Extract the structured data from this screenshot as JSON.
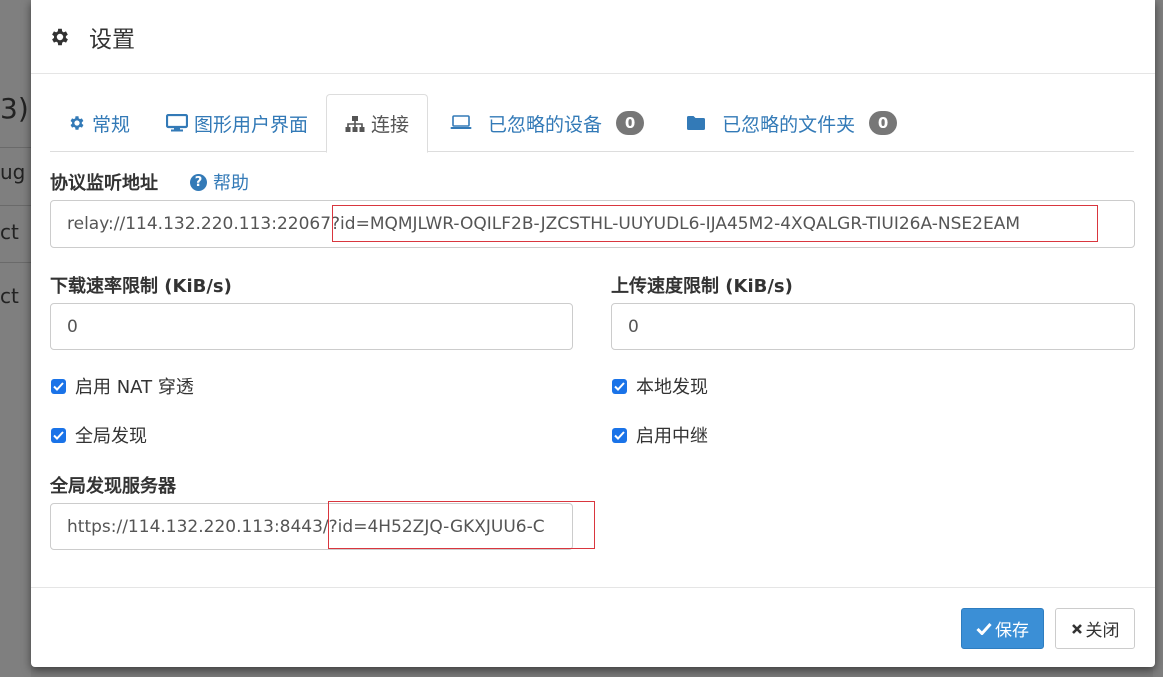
{
  "background": {
    "left_texts": [
      "3)",
      "ug",
      "ct",
      "ct"
    ]
  },
  "dialog": {
    "title": "设置",
    "icon": "gear-icon"
  },
  "tabs": [
    {
      "label": "常规",
      "icon": "cog-icon",
      "active": false
    },
    {
      "label": "图形用户界面",
      "icon": "monitor-icon",
      "active": false
    },
    {
      "label": "连接",
      "icon": "sitemap-icon",
      "active": true
    },
    {
      "label": "已忽略的设备",
      "icon": "laptop-icon",
      "active": false,
      "badge": "0"
    },
    {
      "label": "已忽略的文件夹",
      "icon": "folder-icon",
      "active": false,
      "badge": "0"
    }
  ],
  "form": {
    "listen_label": "协议监听地址",
    "help_label": "帮助",
    "listen_value": "relay://114.132.220.113:22067?id=MQMJLWR-OQILF2B-JZCSTHL-UUYUDL6-IJA45M2-4XQALGR-TIUI26A-NSE2EAM",
    "download_label": "下载速率限制 (KiB/s)",
    "download_value": "0",
    "upload_label": "上传速度限制 (KiB/s)",
    "upload_value": "0",
    "nat_label": "启用 NAT 穿透",
    "local_discovery_label": "本地发现",
    "global_discovery_label": "全局发现",
    "relay_label": "启用中继",
    "global_server_label": "全局发现服务器",
    "global_server_value": "https://114.132.220.113:8443/?id=4H52ZJQ-GKXJUU6-C"
  },
  "footer": {
    "save_label": "保存",
    "close_label": "关闭"
  },
  "colors": {
    "link": "#337ab7",
    "primary": "#3b8fd6",
    "highlight_border": "#d9363e",
    "badge": "#777777"
  }
}
